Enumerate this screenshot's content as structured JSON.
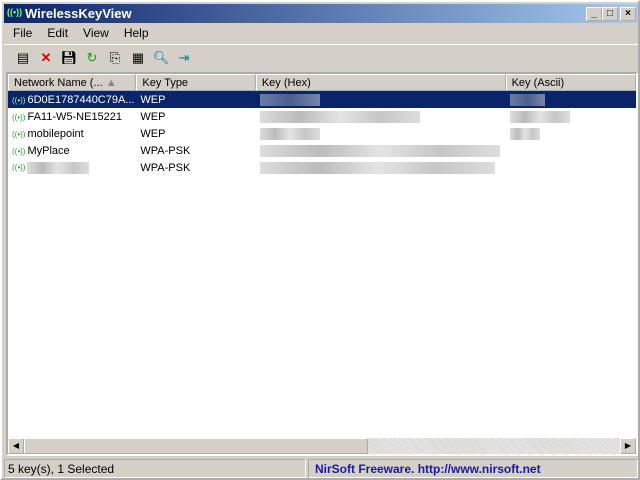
{
  "window": {
    "title": "WirelessKeyView"
  },
  "menu": [
    "File",
    "Edit",
    "View",
    "Help"
  ],
  "toolbar": [
    "properties-icon",
    "delete-icon",
    "save-icon",
    "refresh-icon",
    "copy-icon",
    "report-icon",
    "find-icon",
    "exit-icon"
  ],
  "columns": [
    "Network Name (...",
    "Key Type",
    "Key (Hex)",
    "Key (Ascii)"
  ],
  "rows": [
    {
      "name": "6D0E1787440C79A...",
      "type": "WEP",
      "selected": true
    },
    {
      "name": "FA11-W5-NE15221",
      "type": "WEP",
      "selected": false
    },
    {
      "name": "mobilepoint",
      "type": "WEP",
      "selected": false
    },
    {
      "name": "MyPlace",
      "type": "WPA-PSK",
      "selected": false
    },
    {
      "name": "",
      "type": "WPA-PSK",
      "selected": false
    }
  ],
  "status": {
    "count": "5 key(s), 1 Selected",
    "credit": "NirSoft Freeware.  http://www.nirsoft.net"
  },
  "colors": {
    "accent": "#0a246a",
    "link": "#1a1aa0"
  }
}
